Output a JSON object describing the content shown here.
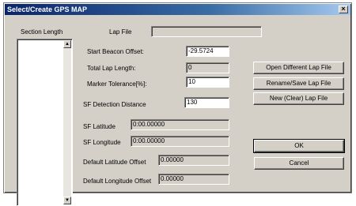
{
  "window": {
    "title": "Select/Create GPS MAP",
    "close_glyph": "×"
  },
  "section_length": {
    "label": "Section Length",
    "scroll_up_glyph": "▲",
    "scroll_down_glyph": "▼"
  },
  "lap_file": {
    "label": "Lap File",
    "value": ""
  },
  "fields": {
    "start_beacon_offset": {
      "label": "Start Beacon Offset:",
      "value": "-29.5724"
    },
    "total_lap_length": {
      "label": "Total Lap Length:",
      "value": "0"
    },
    "marker_tolerance": {
      "label": "Marker Tolerance[%]:",
      "value": "10"
    },
    "sf_detection_distance": {
      "label": "SF Detection Distance",
      "value": "130"
    },
    "sf_latitude": {
      "label": "SF Latitude",
      "value": "0:00.00000"
    },
    "sf_longitude": {
      "label": "SF Longitude",
      "value": "0:00.00000"
    },
    "default_latitude_offset": {
      "label": "Default Latitude Offset",
      "value": "0.00000"
    },
    "default_longitude_offset": {
      "label": "Default Longitude Offset",
      "value": "0.00000"
    }
  },
  "buttons": {
    "open_different_lap_file": "Open Different Lap File",
    "rename_save_lap_file": "Rename/Save Lap File",
    "new_clear_lap_file": "New (Clear) Lap File",
    "ok": "OK",
    "cancel": "Cancel"
  }
}
